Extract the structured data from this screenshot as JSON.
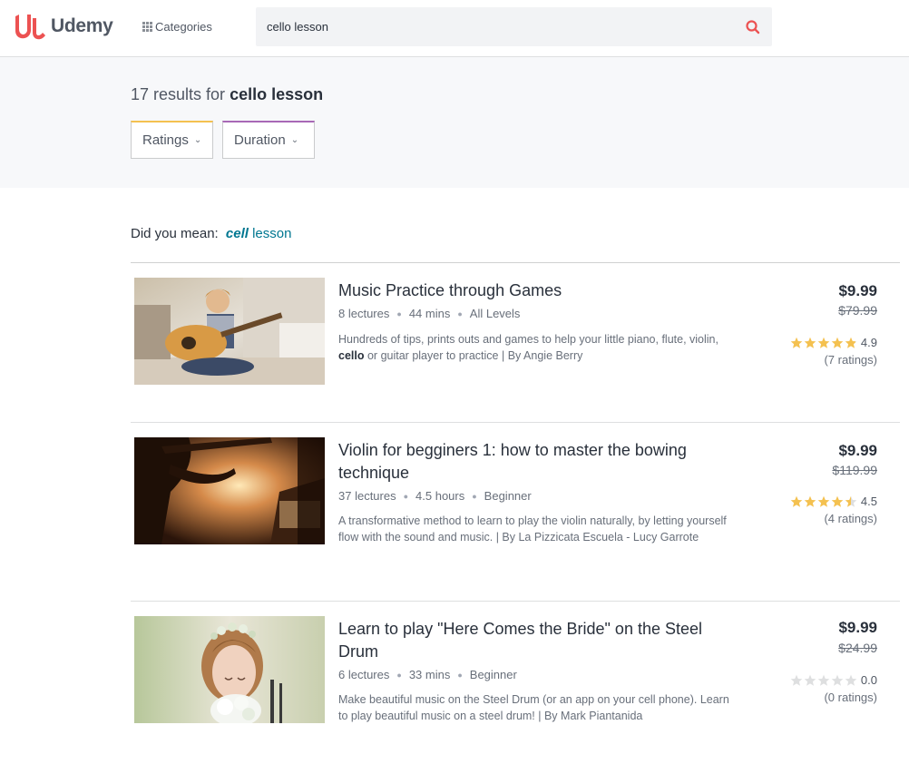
{
  "header": {
    "logo_text": "Udemy",
    "categories_label": "Categories",
    "search_value": "cello lesson",
    "accent": "#ec5252"
  },
  "results": {
    "count_text": "17 results for",
    "query": "cello lesson",
    "filters": [
      "Ratings",
      "Duration"
    ]
  },
  "did_you_mean": {
    "prefix": "Did you mean:",
    "bold_word": "cell",
    "rest": "lesson"
  },
  "courses": [
    {
      "title": "Music Practice through Games",
      "lectures": "8 lectures",
      "length": "44 mins",
      "level": "All Levels",
      "desc_before": "Hundreds of tips, prints outs and games to help your little piano, flute, violin,",
      "desc_bold": "cello",
      "desc_after": "or guitar player to practice | By Angie Berry",
      "price": "$9.99",
      "old_price": "$79.99",
      "rating": "4.9",
      "rating_value": 4.9,
      "ratings_count": "(7 ratings)"
    },
    {
      "title": "Violin for begginers 1: how to master the bowing technique",
      "lectures": "37 lectures",
      "length": "4.5 hours",
      "level": "Beginner",
      "desc_before": "A transformative method to learn to play the violin naturally, by letting yourself flow with the sound and music. | By La Pizzicata Escuela - Lucy Garrote",
      "desc_bold": "",
      "desc_after": "",
      "price": "$9.99",
      "old_price": "$119.99",
      "rating": "4.5",
      "rating_value": 4.5,
      "ratings_count": "(4 ratings)"
    },
    {
      "title": "Learn to play \"Here Comes the Bride\" on the Steel Drum",
      "lectures": "6 lectures",
      "length": "33 mins",
      "level": "Beginner",
      "desc_before": "Make beautiful music on the Steel Drum (or an app on your cell phone). Learn to play beautiful music on a steel drum! | By Mark Piantanida",
      "desc_bold": "",
      "desc_after": "",
      "price": "$9.99",
      "old_price": "$24.99",
      "rating": "0.0",
      "rating_value": 0,
      "ratings_count": "(0 ratings)"
    }
  ],
  "colors": {
    "star_filled": "#f4c150",
    "star_empty": "#dedfe0",
    "link": "#007791"
  }
}
